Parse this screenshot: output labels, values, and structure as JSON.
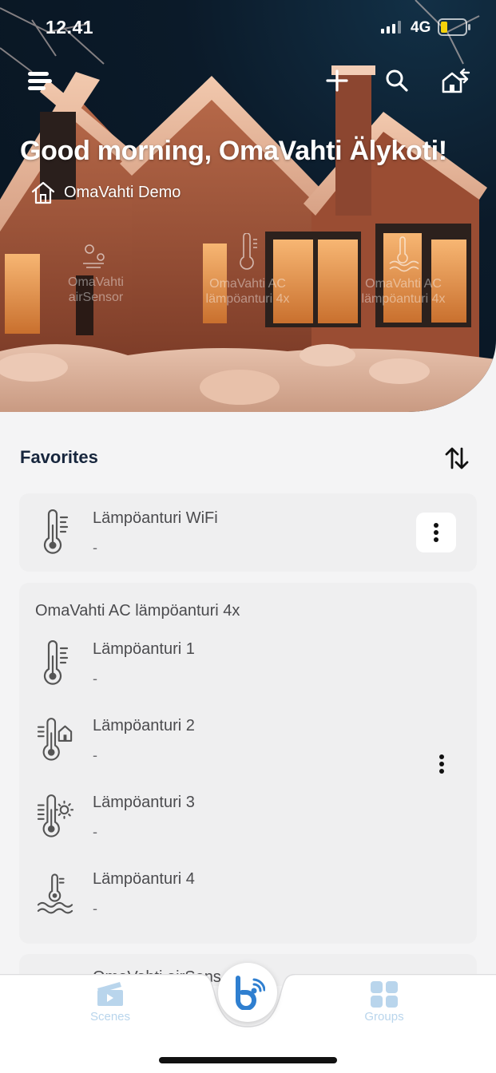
{
  "status_bar": {
    "time": "12.41",
    "network": "4G"
  },
  "header": {
    "greeting": "Good morning, OmaVahti Älykoti!",
    "home_name": "OmaVahti Demo",
    "icons": [
      "menu-icon",
      "add-icon",
      "search-icon",
      "home-switch-icon",
      "home-icon"
    ],
    "overlay_sensors": [
      "OmaVahti airSensor",
      "OmaVahti AC lämpöanturi 4x",
      "OmaVahti AC lämpöanturi 4x"
    ]
  },
  "favorites": {
    "title": "Favorites",
    "single_device": {
      "name": "Lämpöanturi WiFi",
      "value": "-"
    },
    "group": {
      "title": "OmaVahti AC lämpöanturi 4x",
      "sensors": [
        {
          "name": "Lämpöanturi 1",
          "value": "-",
          "icon": "thermometer-icon"
        },
        {
          "name": "Lämpöanturi 2",
          "value": "-",
          "icon": "thermometer-house-icon"
        },
        {
          "name": "Lämpöanturi 3",
          "value": "-",
          "icon": "thermometer-sun-icon"
        },
        {
          "name": "Lämpöanturi 4",
          "value": "-",
          "icon": "thermometer-water-icon"
        }
      ]
    },
    "peek_device": "OmaVahti airSens"
  },
  "bottom_nav": {
    "scenes_label": "Scenes",
    "groups_label": "Groups"
  },
  "colors": {
    "accent": "#2f7fd0",
    "title": "#17263d",
    "nav_inactive": "#b9d5ec",
    "background": "#f4f4f5"
  }
}
